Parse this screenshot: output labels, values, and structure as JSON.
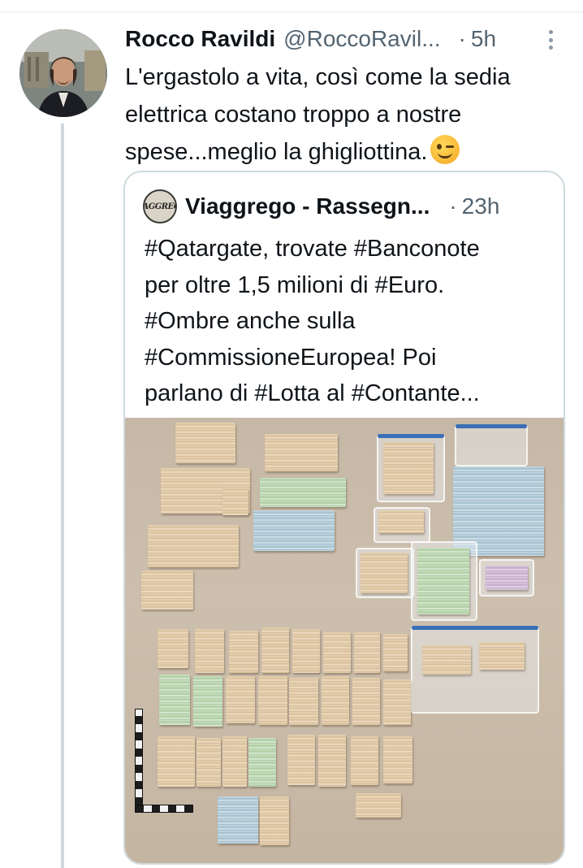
{
  "tweet": {
    "display_name": "Rocco Ravildi",
    "handle": "@RoccoRavil...",
    "separator": "·",
    "time": "5h",
    "text_lines": [
      "L'ergastolo a vita, così come la sedia",
      "elettrica costano troppo a nostre",
      "spese...meglio la ghigliottina."
    ],
    "emoji": "winking-face-emoji",
    "avatar": "profile-photo"
  },
  "quoted_tweet": {
    "display_name": "Viaggrego - Rassegn...",
    "separator": "·",
    "time": "23h",
    "avatar_logo_text": "VIAGGREGO",
    "text_lines": [
      "#Qatargate, trovate #Banconote",
      "per oltre 1,5 milioni di #Euro.",
      "#Ombre anche sulla",
      "#CommissioneEuropea! Poi",
      "parlano di #Lotta al #Contante..."
    ],
    "media": "photo-of-seized-euro-banknote-bundles"
  },
  "icons": {
    "more": "more-vertical-icon"
  },
  "colors": {
    "text_primary": "#0f1419",
    "text_secondary": "#536471",
    "border": "#cfd9de",
    "background": "#ffffff"
  }
}
